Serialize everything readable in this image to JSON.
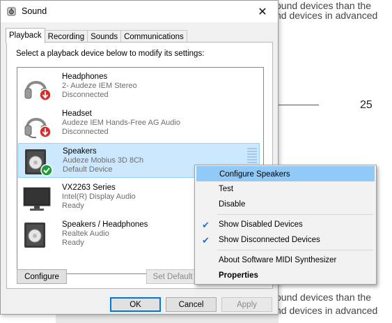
{
  "background": {
    "top_line1": "ound devices than the",
    "top_line2": "nd devices in advanced",
    "page_number": "25",
    "bottom_line1": "ound devices than the",
    "bottom_line2": "nd devices in advanced"
  },
  "dialog": {
    "title": "Sound",
    "close_glyph": "✕",
    "tabs": [
      "Playback",
      "Recording",
      "Sounds",
      "Communications"
    ],
    "instruction": "Select a playback device below to modify its settings:",
    "devices": [
      {
        "name": "Headphones",
        "sub": "2- Audeze IEM Stereo",
        "status": "Disconnected",
        "icon": "headphones-icon",
        "badge": "disconnected-arrow"
      },
      {
        "name": "Headset",
        "sub": "Audeze IEM Hands-Free AG Audio",
        "status": "Disconnected",
        "icon": "headset-icon",
        "badge": "disconnected-arrow"
      },
      {
        "name": "Speakers",
        "sub": "Audeze Mobius 3D 8Ch",
        "status": "Default Device",
        "icon": "speaker-icon",
        "badge": "default-check"
      },
      {
        "name": "VX2263 Series",
        "sub": "Intel(R) Display Audio",
        "status": "Ready",
        "icon": "monitor-icon",
        "badge": ""
      },
      {
        "name": "Speakers / Headphones",
        "sub": "Realtek Audio",
        "status": "Ready",
        "icon": "speaker-icon",
        "badge": ""
      }
    ],
    "buttons": {
      "configure": "Configure",
      "set_default": "Set Default",
      "ok": "OK",
      "cancel": "Cancel",
      "apply": "Apply"
    }
  },
  "context_menu": {
    "items": [
      {
        "label": "Configure Speakers",
        "checked": false
      },
      {
        "label": "Test",
        "checked": false
      },
      {
        "label": "Disable",
        "checked": false
      },
      {
        "label": "Show Disabled Devices",
        "checked": true
      },
      {
        "label": "Show Disconnected Devices",
        "checked": true
      },
      {
        "label": "About Software MIDI Synthesizer",
        "checked": false
      },
      {
        "label": "Properties",
        "checked": false
      }
    ]
  },
  "colors": {
    "selection": "#cce8ff",
    "menu_highlight": "#91c9f7",
    "check": "#2a6ec6",
    "disconnected_badge": "#d32f2f",
    "default_badge": "#1e9e3a"
  }
}
